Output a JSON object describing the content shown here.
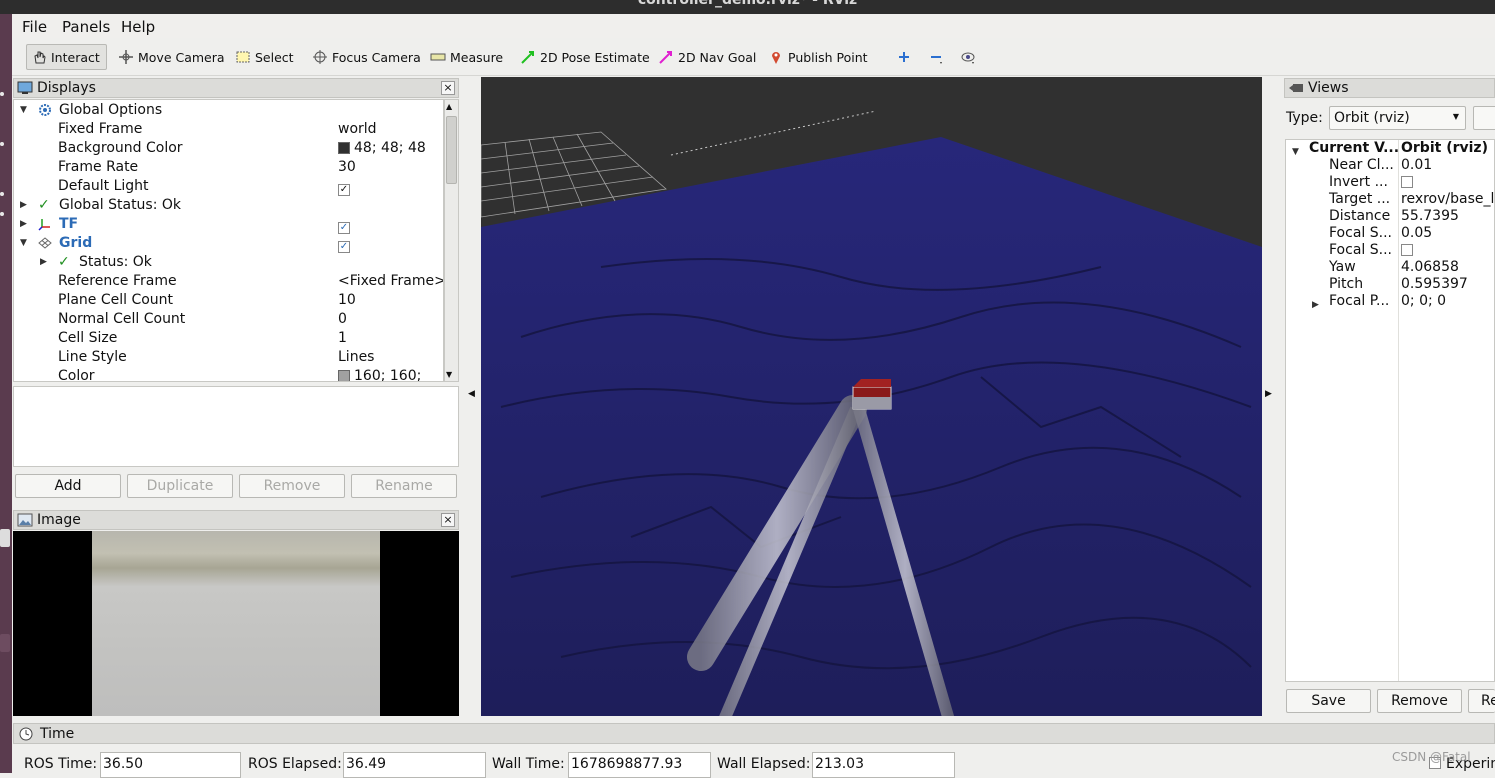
{
  "window": {
    "title": "controller_demo.rviz* - RViz"
  },
  "menu": [
    "File",
    "Panels",
    "Help"
  ],
  "toolbar": {
    "tools": [
      "Interact",
      "Move Camera",
      "Select",
      "Focus Camera",
      "Measure",
      "2D Pose Estimate",
      "2D Nav Goal",
      "Publish Point"
    ],
    "active": "Interact"
  },
  "displays": {
    "title": "Displays",
    "rows": [
      {
        "name": "Global Options",
        "value": ""
      },
      {
        "name": "Fixed Frame",
        "value": "world"
      },
      {
        "name": "Background Color",
        "value": "48; 48; 48"
      },
      {
        "name": "Frame Rate",
        "value": "30"
      },
      {
        "name": "Default Light",
        "value": ""
      },
      {
        "name": "Global Status: Ok",
        "value": ""
      },
      {
        "name": "TF",
        "value": ""
      },
      {
        "name": "Grid",
        "value": ""
      },
      {
        "name": "Status: Ok",
        "value": ""
      },
      {
        "name": "Reference Frame",
        "value": "<Fixed Frame>"
      },
      {
        "name": "Plane Cell Count",
        "value": "10"
      },
      {
        "name": "Normal Cell Count",
        "value": "0"
      },
      {
        "name": "Cell Size",
        "value": "1"
      },
      {
        "name": "Line Style",
        "value": "Lines"
      },
      {
        "name": "Color",
        "value": "160; 160;"
      }
    ],
    "buttons": {
      "add": "Add",
      "duplicate": "Duplicate",
      "remove": "Remove",
      "rename": "Rename"
    }
  },
  "image_panel": {
    "title": "Image"
  },
  "views": {
    "title": "Views",
    "type_label": "Type:",
    "type_value": "Orbit (rviz)",
    "header": {
      "name": "Current V...",
      "value": "Orbit (rviz)"
    },
    "rows": [
      {
        "name": "Near Cl...",
        "value": "0.01"
      },
      {
        "name": "Invert ...",
        "value": ""
      },
      {
        "name": "Target ...",
        "value": "rexrov/base_li"
      },
      {
        "name": "Distance",
        "value": "55.7395"
      },
      {
        "name": "Focal S...",
        "value": "0.05"
      },
      {
        "name": "Focal S...",
        "value": ""
      },
      {
        "name": "Yaw",
        "value": "4.06858"
      },
      {
        "name": "Pitch",
        "value": "0.595397"
      },
      {
        "name": "Focal P...",
        "value": "0; 0; 0"
      }
    ],
    "buttons": {
      "save": "Save",
      "remove": "Remove",
      "rename": "Re"
    }
  },
  "time": {
    "title": "Time",
    "ros_time_label": "ROS Time:",
    "ros_time": "36.50",
    "ros_elapsed_label": "ROS Elapsed:",
    "ros_elapsed": "36.49",
    "wall_time_label": "Wall Time:",
    "wall_time": "1678698877.93",
    "wall_elapsed_label": "Wall Elapsed:",
    "wall_elapsed": "213.03",
    "experimental_label": "Experin"
  },
  "watermark": "CSDN @Fatal",
  "colors": {
    "background": "#303030",
    "seabed": "#23236a",
    "grid": "#a0a0a0",
    "status_ok": "#1f8f1f",
    "link_blue": "#2c6bb6"
  }
}
